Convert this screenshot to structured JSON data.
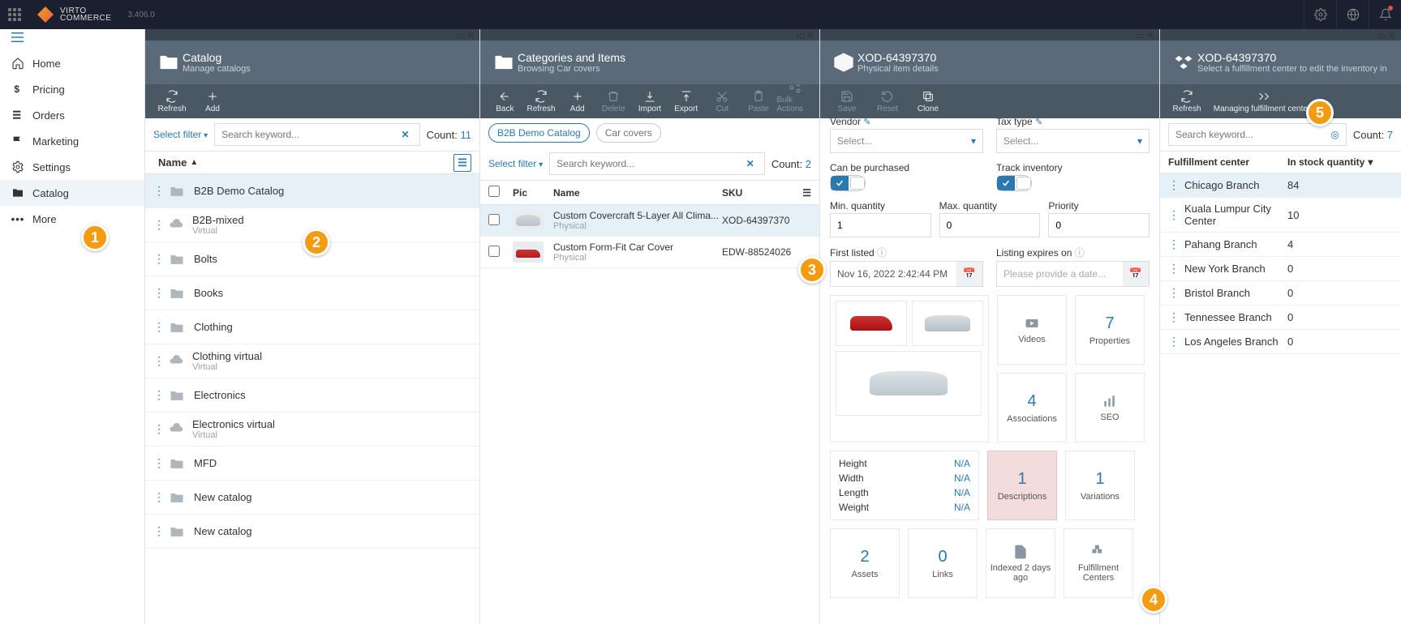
{
  "topbar": {
    "brand_line1": "VIRTO",
    "brand_line2": "COMMERCE",
    "version": "3.406.0"
  },
  "sidenav": {
    "items": [
      {
        "label": "Home",
        "icon": "home"
      },
      {
        "label": "Pricing",
        "icon": "dollar"
      },
      {
        "label": "Orders",
        "icon": "list"
      },
      {
        "label": "Marketing",
        "icon": "flag"
      },
      {
        "label": "Settings",
        "icon": "gear"
      },
      {
        "label": "Catalog",
        "icon": "folder",
        "selected": true
      },
      {
        "label": "More",
        "icon": "dots"
      }
    ]
  },
  "blade1": {
    "title": "Catalog",
    "subtitle": "Manage catalogs",
    "toolbar": {
      "refresh": "Refresh",
      "add": "Add"
    },
    "filter_label": "Select filter",
    "search_placeholder": "Search keyword...",
    "count_label": "Count:",
    "count_value": "11",
    "name_header": "Name",
    "rows": [
      {
        "name": "B2B Demo Catalog",
        "sub": "",
        "type": "folder",
        "selected": true
      },
      {
        "name": "B2B-mixed",
        "sub": "Virtual",
        "type": "cloud"
      },
      {
        "name": "Bolts",
        "sub": "",
        "type": "folder"
      },
      {
        "name": "Books",
        "sub": "",
        "type": "folder"
      },
      {
        "name": "Clothing",
        "sub": "",
        "type": "folder"
      },
      {
        "name": "Clothing virtual",
        "sub": "Virtual",
        "type": "cloud"
      },
      {
        "name": "Electronics",
        "sub": "",
        "type": "folder"
      },
      {
        "name": "Electronics virtual",
        "sub": "Virtual",
        "type": "cloud"
      },
      {
        "name": "MFD",
        "sub": "",
        "type": "folder"
      },
      {
        "name": "New catalog",
        "sub": "",
        "type": "folder"
      },
      {
        "name": "New catalog",
        "sub": "",
        "type": "folder"
      }
    ]
  },
  "blade2": {
    "title": "Categories and Items",
    "subtitle": "Browsing Car covers",
    "toolbar": {
      "back": "Back",
      "refresh": "Refresh",
      "add": "Add",
      "delete": "Delete",
      "import": "Import",
      "export": "Export",
      "cut": "Cut",
      "paste": "Paste",
      "bulk": "Bulk Actions"
    },
    "tags": [
      "B2B Demo Catalog",
      "Car covers"
    ],
    "filter_label": "Select filter",
    "search_placeholder": "Search keyword...",
    "count_label": "Count:",
    "count_value": "2",
    "headers": {
      "pic": "Pic",
      "name": "Name",
      "sku": "SKU"
    },
    "rows": [
      {
        "name": "Custom Covercraft 5-Layer All Clima...",
        "sub": "Physical",
        "sku": "XOD-64397370",
        "selected": true,
        "color": "silver"
      },
      {
        "name": "Custom Form-Fit Car Cover",
        "sub": "Physical",
        "sku": "EDW-88524026",
        "color": "red"
      }
    ]
  },
  "blade3": {
    "title": "XOD-64397370",
    "subtitle": "Physical item details",
    "toolbar": {
      "save": "Save",
      "reset": "Reset",
      "clone": "Clone"
    },
    "labels": {
      "vendor": "Vendor",
      "tax": "Tax type",
      "select": "Select...",
      "can_purchase": "Can be purchased",
      "track_inventory": "Track inventory",
      "min_qty": "Min. quantity",
      "max_qty": "Max. quantity",
      "priority": "Priority",
      "first_listed": "First listed",
      "listing_expires": "Listing expires on",
      "provide_date": "Please provide a date..."
    },
    "values": {
      "min_qty": "1",
      "max_qty": "0",
      "priority": "0",
      "first_listed": "Nov 16, 2022 2:42:44 PM"
    },
    "tiles": {
      "videos": "Videos",
      "properties": "Properties",
      "props_n": "7",
      "associations": "Associations",
      "assoc_n": "4",
      "seo": "SEO",
      "descriptions": "Descriptions",
      "desc_n": "1",
      "variations": "Variations",
      "var_n": "1",
      "assets": "Assets",
      "assets_n": "2",
      "links": "Links",
      "links_n": "0",
      "indexed": "Indexed 2 days ago",
      "fulfillment": "Fulfillment Centers"
    },
    "dims": {
      "height": "Height",
      "width": "Width",
      "length": "Length",
      "weight": "Weight",
      "na": "N/A"
    }
  },
  "blade4": {
    "title": "XOD-64397370",
    "subtitle": "Select a fulfillment center to edit the inventory in",
    "toolbar": {
      "refresh": "Refresh",
      "manage": "Managing fulfillment centers"
    },
    "search_placeholder": "Search keyword...",
    "count_label": "Count:",
    "count_value": "7",
    "headers": {
      "fc": "Fulfillment center",
      "qty": "In stock quantity"
    },
    "rows": [
      {
        "name": "Chicago Branch",
        "qty": "84",
        "selected": true
      },
      {
        "name": "Kuala Lumpur City Center",
        "qty": "10"
      },
      {
        "name": "Pahang Branch",
        "qty": "4"
      },
      {
        "name": "New York Branch",
        "qty": "0"
      },
      {
        "name": "Bristol Branch",
        "qty": "0"
      },
      {
        "name": "Tennessee Branch",
        "qty": "0"
      },
      {
        "name": "Los Angeles Branch",
        "qty": "0"
      }
    ]
  },
  "badges": {
    "b1": "1",
    "b2": "2",
    "b3": "3",
    "b4": "4",
    "b5": "5"
  }
}
